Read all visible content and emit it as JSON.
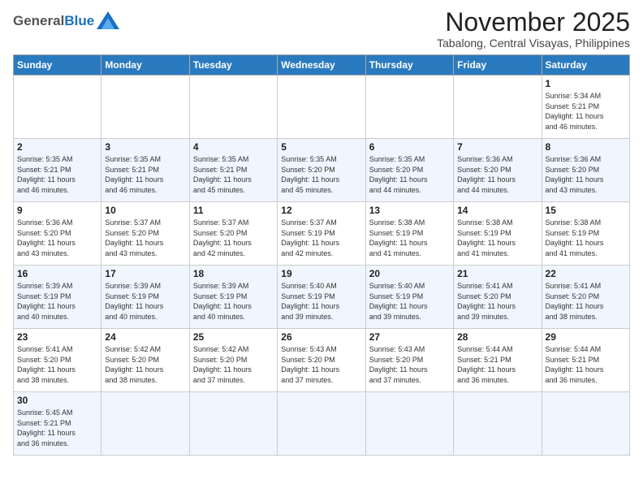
{
  "header": {
    "logo_general": "General",
    "logo_blue": "Blue",
    "month_title": "November 2025",
    "location": "Tabalong, Central Visayas, Philippines"
  },
  "weekdays": [
    "Sunday",
    "Monday",
    "Tuesday",
    "Wednesday",
    "Thursday",
    "Friday",
    "Saturday"
  ],
  "weeks": [
    [
      {
        "day": "",
        "info": ""
      },
      {
        "day": "",
        "info": ""
      },
      {
        "day": "",
        "info": ""
      },
      {
        "day": "",
        "info": ""
      },
      {
        "day": "",
        "info": ""
      },
      {
        "day": "",
        "info": ""
      },
      {
        "day": "1",
        "info": "Sunrise: 5:34 AM\nSunset: 5:21 PM\nDaylight: 11 hours\nand 46 minutes."
      }
    ],
    [
      {
        "day": "2",
        "info": "Sunrise: 5:35 AM\nSunset: 5:21 PM\nDaylight: 11 hours\nand 46 minutes."
      },
      {
        "day": "3",
        "info": "Sunrise: 5:35 AM\nSunset: 5:21 PM\nDaylight: 11 hours\nand 46 minutes."
      },
      {
        "day": "4",
        "info": "Sunrise: 5:35 AM\nSunset: 5:21 PM\nDaylight: 11 hours\nand 45 minutes."
      },
      {
        "day": "5",
        "info": "Sunrise: 5:35 AM\nSunset: 5:20 PM\nDaylight: 11 hours\nand 45 minutes."
      },
      {
        "day": "6",
        "info": "Sunrise: 5:35 AM\nSunset: 5:20 PM\nDaylight: 11 hours\nand 44 minutes."
      },
      {
        "day": "7",
        "info": "Sunrise: 5:36 AM\nSunset: 5:20 PM\nDaylight: 11 hours\nand 44 minutes."
      },
      {
        "day": "8",
        "info": "Sunrise: 5:36 AM\nSunset: 5:20 PM\nDaylight: 11 hours\nand 43 minutes."
      }
    ],
    [
      {
        "day": "9",
        "info": "Sunrise: 5:36 AM\nSunset: 5:20 PM\nDaylight: 11 hours\nand 43 minutes."
      },
      {
        "day": "10",
        "info": "Sunrise: 5:37 AM\nSunset: 5:20 PM\nDaylight: 11 hours\nand 43 minutes."
      },
      {
        "day": "11",
        "info": "Sunrise: 5:37 AM\nSunset: 5:20 PM\nDaylight: 11 hours\nand 42 minutes."
      },
      {
        "day": "12",
        "info": "Sunrise: 5:37 AM\nSunset: 5:19 PM\nDaylight: 11 hours\nand 42 minutes."
      },
      {
        "day": "13",
        "info": "Sunrise: 5:38 AM\nSunset: 5:19 PM\nDaylight: 11 hours\nand 41 minutes."
      },
      {
        "day": "14",
        "info": "Sunrise: 5:38 AM\nSunset: 5:19 PM\nDaylight: 11 hours\nand 41 minutes."
      },
      {
        "day": "15",
        "info": "Sunrise: 5:38 AM\nSunset: 5:19 PM\nDaylight: 11 hours\nand 41 minutes."
      }
    ],
    [
      {
        "day": "16",
        "info": "Sunrise: 5:39 AM\nSunset: 5:19 PM\nDaylight: 11 hours\nand 40 minutes."
      },
      {
        "day": "17",
        "info": "Sunrise: 5:39 AM\nSunset: 5:19 PM\nDaylight: 11 hours\nand 40 minutes."
      },
      {
        "day": "18",
        "info": "Sunrise: 5:39 AM\nSunset: 5:19 PM\nDaylight: 11 hours\nand 40 minutes."
      },
      {
        "day": "19",
        "info": "Sunrise: 5:40 AM\nSunset: 5:19 PM\nDaylight: 11 hours\nand 39 minutes."
      },
      {
        "day": "20",
        "info": "Sunrise: 5:40 AM\nSunset: 5:19 PM\nDaylight: 11 hours\nand 39 minutes."
      },
      {
        "day": "21",
        "info": "Sunrise: 5:41 AM\nSunset: 5:20 PM\nDaylight: 11 hours\nand 39 minutes."
      },
      {
        "day": "22",
        "info": "Sunrise: 5:41 AM\nSunset: 5:20 PM\nDaylight: 11 hours\nand 38 minutes."
      }
    ],
    [
      {
        "day": "23",
        "info": "Sunrise: 5:41 AM\nSunset: 5:20 PM\nDaylight: 11 hours\nand 38 minutes."
      },
      {
        "day": "24",
        "info": "Sunrise: 5:42 AM\nSunset: 5:20 PM\nDaylight: 11 hours\nand 38 minutes."
      },
      {
        "day": "25",
        "info": "Sunrise: 5:42 AM\nSunset: 5:20 PM\nDaylight: 11 hours\nand 37 minutes."
      },
      {
        "day": "26",
        "info": "Sunrise: 5:43 AM\nSunset: 5:20 PM\nDaylight: 11 hours\nand 37 minutes."
      },
      {
        "day": "27",
        "info": "Sunrise: 5:43 AM\nSunset: 5:20 PM\nDaylight: 11 hours\nand 37 minutes."
      },
      {
        "day": "28",
        "info": "Sunrise: 5:44 AM\nSunset: 5:21 PM\nDaylight: 11 hours\nand 36 minutes."
      },
      {
        "day": "29",
        "info": "Sunrise: 5:44 AM\nSunset: 5:21 PM\nDaylight: 11 hours\nand 36 minutes."
      }
    ],
    [
      {
        "day": "30",
        "info": "Sunrise: 5:45 AM\nSunset: 5:21 PM\nDaylight: 11 hours\nand 36 minutes."
      },
      {
        "day": "",
        "info": ""
      },
      {
        "day": "",
        "info": ""
      },
      {
        "day": "",
        "info": ""
      },
      {
        "day": "",
        "info": ""
      },
      {
        "day": "",
        "info": ""
      },
      {
        "day": "",
        "info": ""
      }
    ]
  ]
}
